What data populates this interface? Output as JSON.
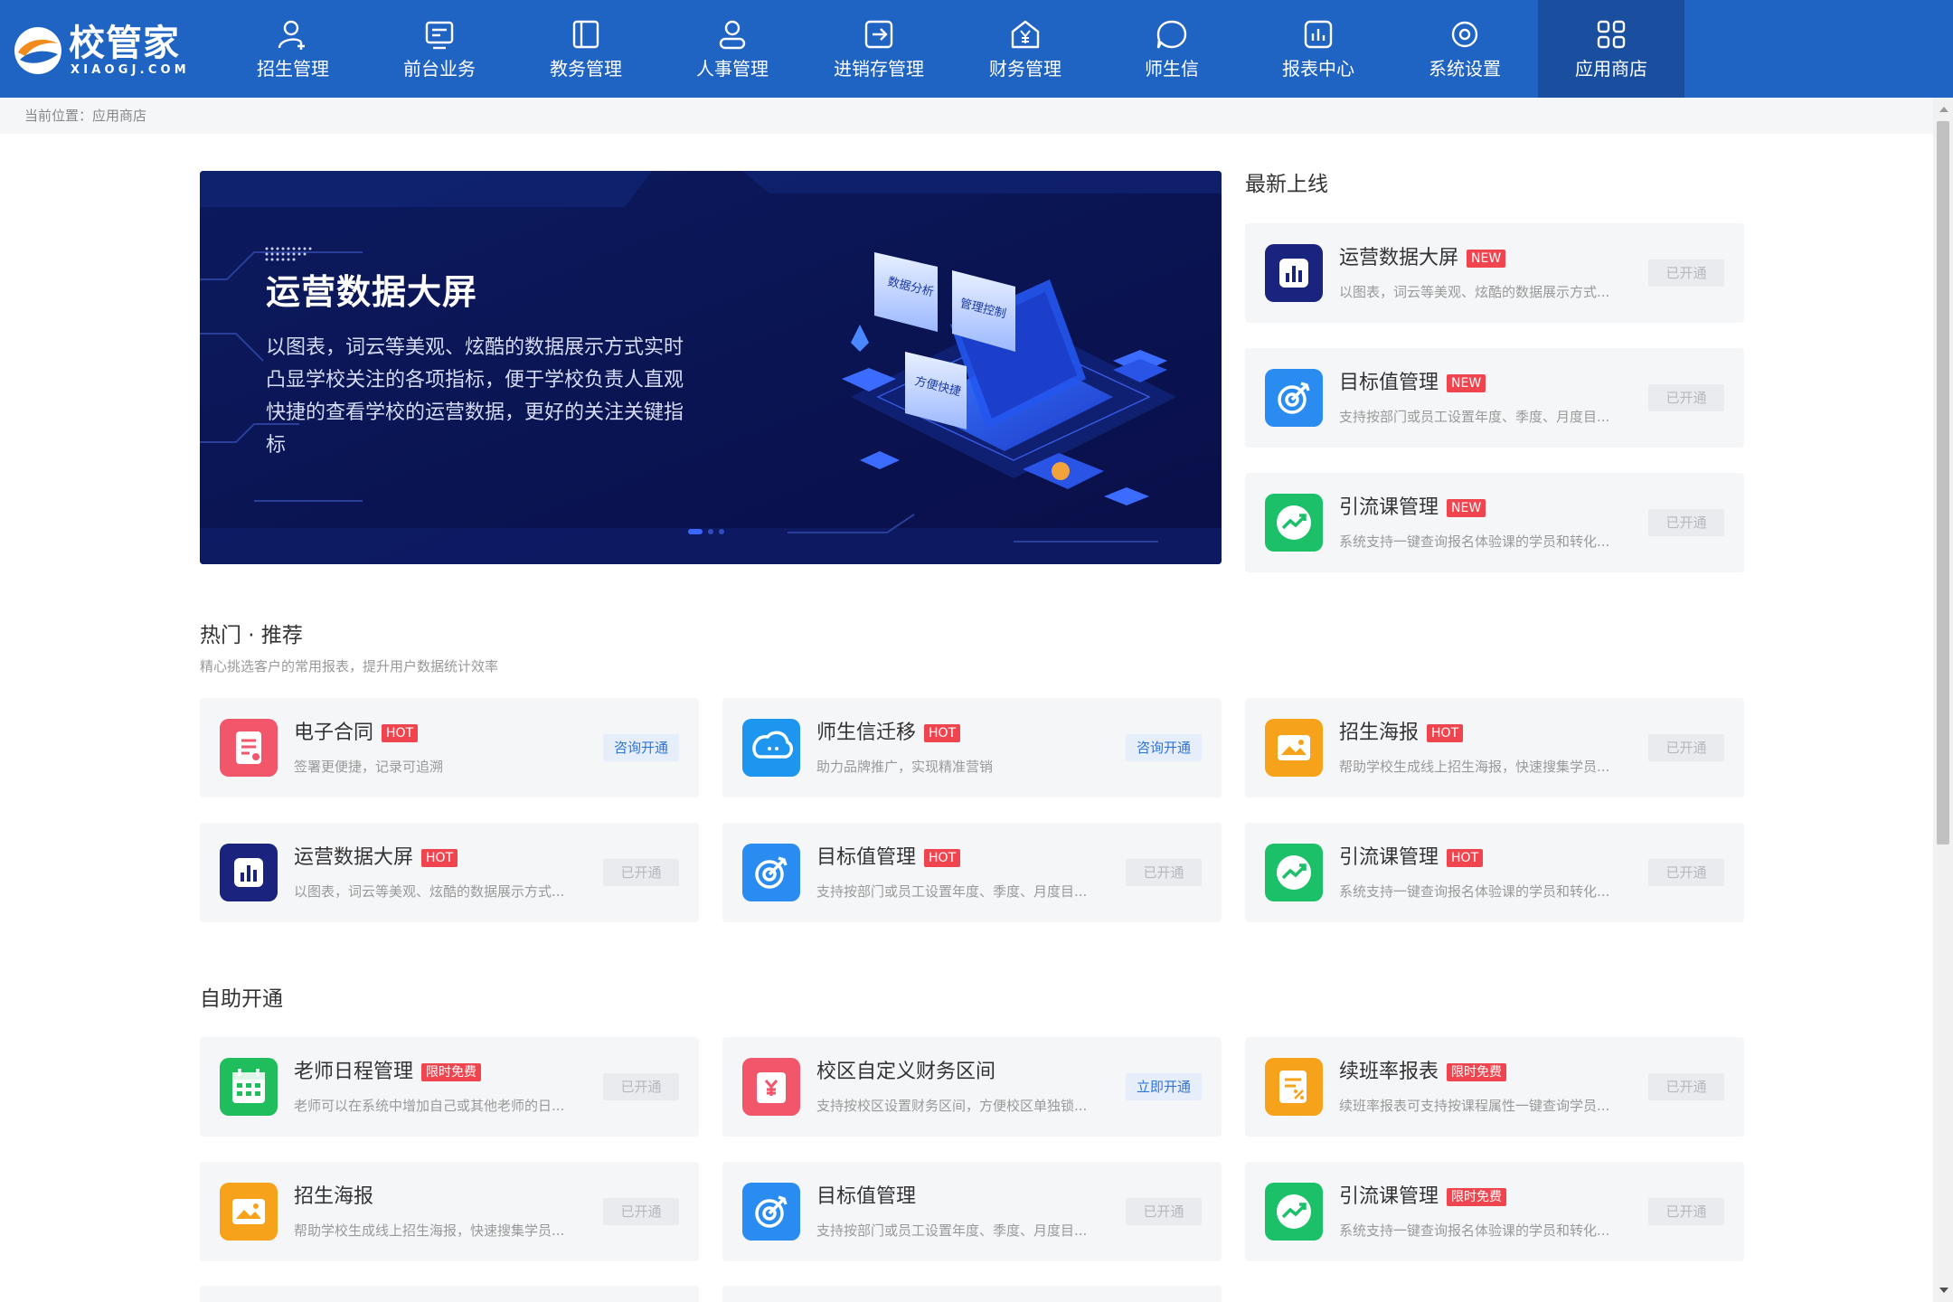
{
  "brand": {
    "title": "校管家",
    "subtitle": "XIAOGJ.COM"
  },
  "nav": [
    {
      "label": "招生管理",
      "icon": "user-plus-icon",
      "active": false
    },
    {
      "label": "前台业务",
      "icon": "monitor-icon",
      "active": false
    },
    {
      "label": "教务管理",
      "icon": "book-icon",
      "active": false
    },
    {
      "label": "人事管理",
      "icon": "person-icon",
      "active": false
    },
    {
      "label": "进销存管理",
      "icon": "inventory-icon",
      "active": false
    },
    {
      "label": "财务管理",
      "icon": "yuan-house-icon",
      "active": false
    },
    {
      "label": "师生信",
      "icon": "chat-icon",
      "active": false
    },
    {
      "label": "报表中心",
      "icon": "report-icon",
      "active": false
    },
    {
      "label": "系统设置",
      "icon": "settings-icon",
      "active": false
    },
    {
      "label": "应用商店",
      "icon": "app-grid-icon",
      "active": true
    }
  ],
  "breadcrumb": "当前位置：应用商店",
  "banner": {
    "title": "运营数据大屏",
    "description": "以图表，词云等美观、炫酷的数据展示方式实时凸显学校关注的各项指标，便于学校负责人直观快捷的查看学校的运营数据，更好的关注关键指标",
    "art_labels": [
      "数据分析",
      "管理控制",
      "方便快捷"
    ],
    "pages": 3,
    "current_page": 1
  },
  "newest": {
    "title": "最新上线",
    "items": [
      {
        "title": "运营数据大屏",
        "tag": "NEW",
        "desc": "以图表，词云等美观、炫酷的数据展示方式...",
        "button": "已开通",
        "button_active": false,
        "icon": "bar-chart-icon",
        "color": "#1a237e"
      },
      {
        "title": "目标值管理",
        "tag": "NEW",
        "desc": "支持按部门或员工设置年度、季度、月度目...",
        "button": "已开通",
        "button_active": false,
        "icon": "target-icon",
        "color": "#2a8cf0"
      },
      {
        "title": "引流课管理",
        "tag": "NEW",
        "desc": "系统支持一键查询报名体验课的学员和转化...",
        "button": "已开通",
        "button_active": false,
        "icon": "trend-icon",
        "color": "#1bc068"
      }
    ]
  },
  "hot": {
    "title": "热门 · 推荐",
    "subtitle": "精心挑选客户的常用报表，提升用户数据统计效率",
    "items": [
      {
        "title": "电子合同",
        "tag": "HOT",
        "desc": "签署更便捷，记录可追溯",
        "button": "咨询开通",
        "button_active": true,
        "icon": "contract-icon",
        "color": "#f2566a"
      },
      {
        "title": "师生信迁移",
        "tag": "HOT",
        "desc": "助力品牌推广，实现精准营销",
        "button": "咨询开通",
        "button_active": true,
        "icon": "message-cloud-icon",
        "color": "#1e95ee"
      },
      {
        "title": "招生海报",
        "tag": "HOT",
        "desc": "帮助学校生成线上招生海报，快速搜集学员...",
        "button": "已开通",
        "button_active": false,
        "icon": "poster-icon",
        "color": "#f7a21b"
      },
      {
        "title": "运营数据大屏",
        "tag": "HOT",
        "desc": "以图表，词云等美观、炫酷的数据展示方式...",
        "button": "已开通",
        "button_active": false,
        "icon": "bar-chart-icon",
        "color": "#1a237e"
      },
      {
        "title": "目标值管理",
        "tag": "HOT",
        "desc": "支持按部门或员工设置年度、季度、月度目...",
        "button": "已开通",
        "button_active": false,
        "icon": "target-icon",
        "color": "#2a8cf0"
      },
      {
        "title": "引流课管理",
        "tag": "HOT",
        "desc": "系统支持一键查询报名体验课的学员和转化...",
        "button": "已开通",
        "button_active": false,
        "icon": "trend-icon",
        "color": "#1bc068"
      }
    ]
  },
  "self_service": {
    "title": "自助开通",
    "items": [
      {
        "title": "老师日程管理",
        "tag": "限时免费",
        "desc": "老师可以在系统中增加自己或其他老师的日...",
        "button": "已开通",
        "button_active": false,
        "icon": "calendar-icon",
        "color": "#1fbd5c"
      },
      {
        "title": "校区自定义财务区间",
        "tag": "",
        "desc": "支持按校区设置财务区间，方便校区单独锁...",
        "button": "立即开通",
        "button_active": true,
        "icon": "finance-icon",
        "color": "#f2566a"
      },
      {
        "title": "续班率报表",
        "tag": "限时免费",
        "desc": "续班率报表可支持按课程属性一键查询学员...",
        "button": "已开通",
        "button_active": false,
        "icon": "percent-report-icon",
        "color": "#f7a21b"
      },
      {
        "title": "招生海报",
        "tag": "",
        "desc": "帮助学校生成线上招生海报，快速搜集学员...",
        "button": "已开通",
        "button_active": false,
        "icon": "poster-icon",
        "color": "#f7a21b"
      },
      {
        "title": "目标值管理",
        "tag": "",
        "desc": "支持按部门或员工设置年度、季度、月度目...",
        "button": "已开通",
        "button_active": false,
        "icon": "target-icon",
        "color": "#2a8cf0"
      },
      {
        "title": "引流课管理",
        "tag": "限时免费",
        "desc": "系统支持一键查询报名体验课的学员和转化...",
        "button": "已开通",
        "button_active": false,
        "icon": "trend-icon",
        "color": "#1bc068"
      }
    ]
  }
}
